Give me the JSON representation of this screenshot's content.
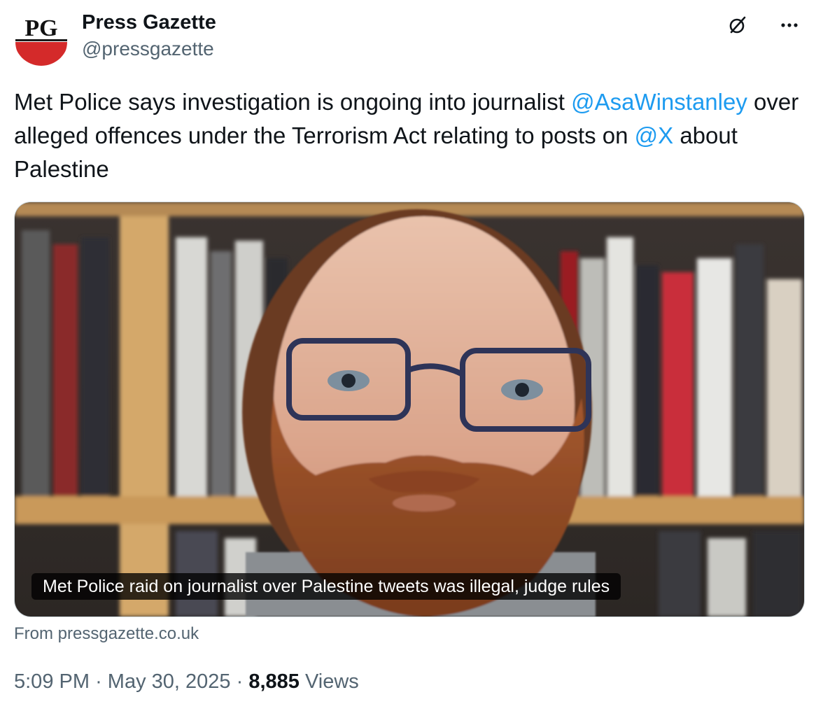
{
  "author": {
    "avatar_text": "PG",
    "display_name": "Press Gazette",
    "handle": "@pressgazette"
  },
  "header_icons": {
    "grok": "grok-icon",
    "more": "more-icon"
  },
  "tweet": {
    "text_part1": "Met Police says investigation is ongoing into journalist ",
    "mention1": "@AsaWinstanley",
    "text_part2": " over alleged offences under the Terrorism Act relating to posts on ",
    "mention2": "@X",
    "text_part3": " about Palestine"
  },
  "card": {
    "caption": "Met Police raid on journalist over Palestine tweets was illegal, judge rules",
    "source": "From pressgazette.co.uk"
  },
  "meta": {
    "time": "5:09 PM",
    "separator": "·",
    "date": "May 30, 2025",
    "views_count": "8,885",
    "views_label": "Views"
  },
  "colors": {
    "accent": "#1d9bf0",
    "secondary_text": "#536471",
    "primary_text": "#0f1419",
    "logo_red": "#d42a2a"
  }
}
